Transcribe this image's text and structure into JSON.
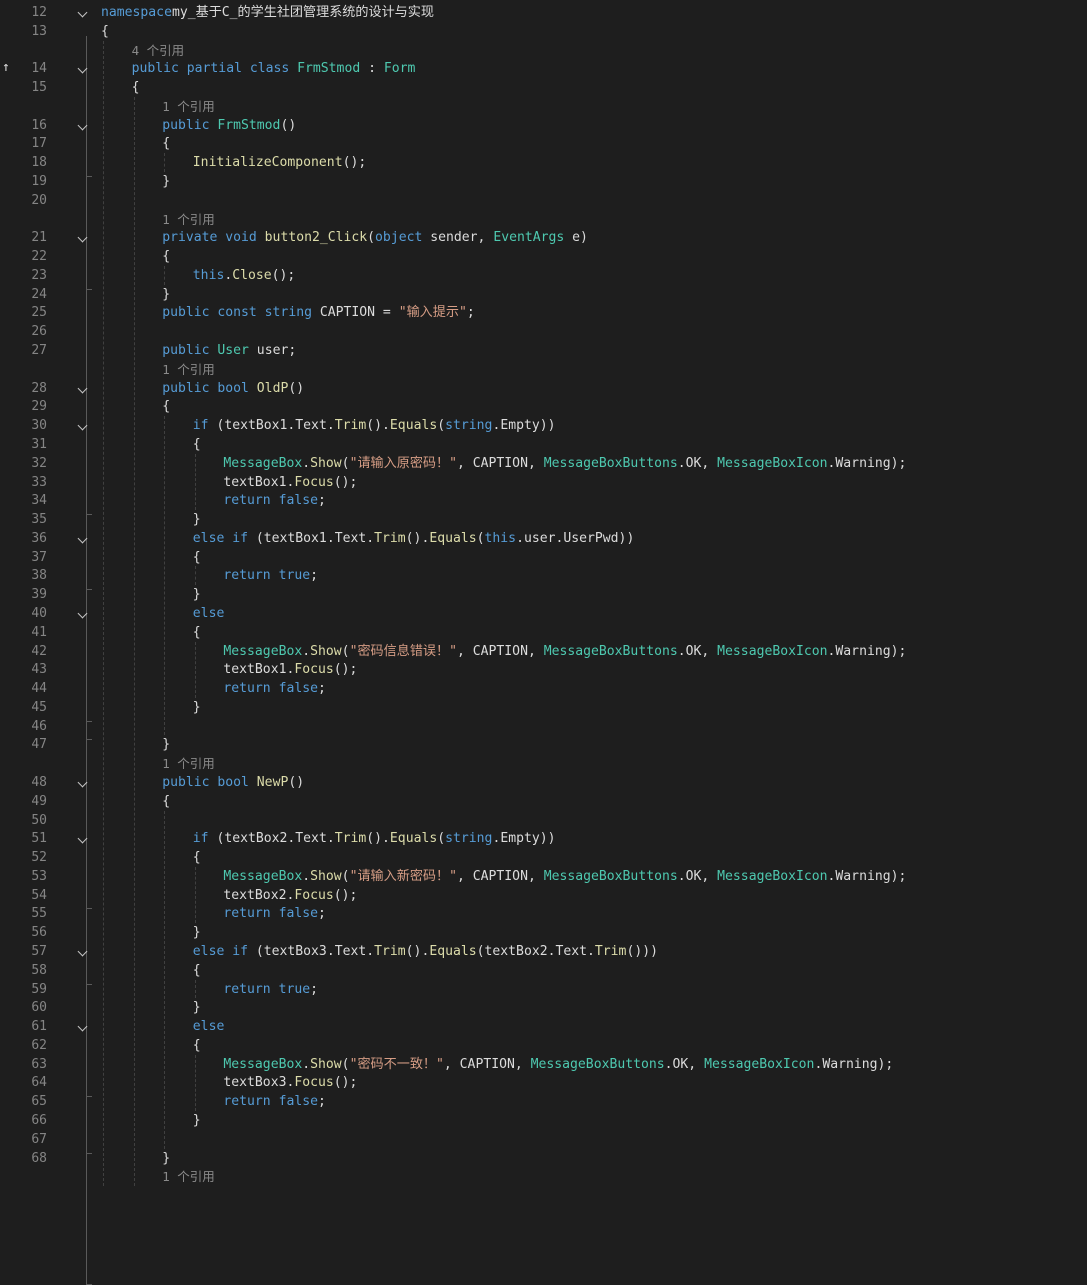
{
  "lines": [
    {
      "n": "12",
      "fold": true,
      "i": 0,
      "tokens": [
        [
          "k",
          "namespace"
        ],
        [
          "",
          "my_基于C_的学生社团管理系统的设计与实现"
        ]
      ]
    },
    {
      "n": "13",
      "i": 0,
      "tokens": [
        [
          "",
          "{"
        ]
      ]
    },
    {
      "i": 1,
      "lens": "4 个引用"
    },
    {
      "n": "14",
      "fold": true,
      "i": 1,
      "tokens": [
        [
          "k",
          "public partial class "
        ],
        [
          "t",
          "FrmStmod"
        ],
        [
          "",
          " : "
        ],
        [
          "t",
          "Form"
        ]
      ]
    },
    {
      "n": "15",
      "i": 1,
      "tokens": [
        [
          "",
          "{"
        ]
      ]
    },
    {
      "i": 2,
      "lens": "1 个引用"
    },
    {
      "n": "16",
      "fold": true,
      "i": 2,
      "tokens": [
        [
          "k",
          "public "
        ],
        [
          "t",
          "FrmStmod"
        ],
        [
          "",
          "()"
        ]
      ]
    },
    {
      "n": "17",
      "i": 2,
      "tokens": [
        [
          "",
          "{"
        ]
      ]
    },
    {
      "n": "18",
      "i": 3,
      "tokens": [
        [
          "m",
          "InitializeComponent"
        ],
        [
          "",
          "();"
        ]
      ]
    },
    {
      "n": "19",
      "i": 2,
      "tokens": [
        [
          "",
          "}"
        ]
      ]
    },
    {
      "n": "20",
      "i": 2,
      "tokens": []
    },
    {
      "i": 2,
      "lens": "1 个引用"
    },
    {
      "n": "21",
      "fold": true,
      "i": 2,
      "tokens": [
        [
          "k",
          "private void "
        ],
        [
          "m",
          "button2_Click"
        ],
        [
          "",
          "("
        ],
        [
          "k",
          "object"
        ],
        [
          "",
          " sender, "
        ],
        [
          "t",
          "EventArgs"
        ],
        [
          "",
          " e)"
        ]
      ]
    },
    {
      "n": "22",
      "i": 2,
      "tokens": [
        [
          "",
          "{"
        ]
      ]
    },
    {
      "n": "23",
      "i": 3,
      "tokens": [
        [
          "k",
          "this"
        ],
        [
          "",
          "."
        ],
        [
          "m",
          "Close"
        ],
        [
          "",
          "();"
        ]
      ]
    },
    {
      "n": "24",
      "i": 2,
      "tokens": [
        [
          "",
          "}"
        ]
      ]
    },
    {
      "n": "25",
      "i": 2,
      "tokens": [
        [
          "k",
          "public const string "
        ],
        [
          "",
          "CAPTION = "
        ],
        [
          "s",
          "\"输入提示\""
        ],
        [
          "",
          ";"
        ]
      ]
    },
    {
      "n": "26",
      "i": 2,
      "tokens": []
    },
    {
      "n": "27",
      "i": 2,
      "tokens": [
        [
          "k",
          "public "
        ],
        [
          "t",
          "User"
        ],
        [
          "",
          " user;"
        ]
      ]
    },
    {
      "i": 2,
      "lens": "1 个引用"
    },
    {
      "n": "28",
      "fold": true,
      "i": 2,
      "tokens": [
        [
          "k",
          "public bool "
        ],
        [
          "m",
          "OldP"
        ],
        [
          "",
          "()"
        ]
      ]
    },
    {
      "n": "29",
      "i": 2,
      "tokens": [
        [
          "",
          "{"
        ]
      ]
    },
    {
      "n": "30",
      "fold": true,
      "i": 3,
      "tokens": [
        [
          "k",
          "if"
        ],
        [
          "",
          " (textBox1.Text."
        ],
        [
          "m",
          "Trim"
        ],
        [
          "",
          "()."
        ],
        [
          "m",
          "Equals"
        ],
        [
          "",
          "("
        ],
        [
          "k",
          "string"
        ],
        [
          "",
          ".Empty))"
        ]
      ]
    },
    {
      "n": "31",
      "i": 3,
      "tokens": [
        [
          "",
          "{"
        ]
      ]
    },
    {
      "n": "32",
      "i": 4,
      "tokens": [
        [
          "t",
          "MessageBox"
        ],
        [
          "",
          "."
        ],
        [
          "m",
          "Show"
        ],
        [
          "",
          "("
        ],
        [
          "s",
          "\"请输入原密码！\""
        ],
        [
          "",
          ", CAPTION, "
        ],
        [
          "t",
          "MessageBoxButtons"
        ],
        [
          "",
          ".OK, "
        ],
        [
          "t",
          "MessageBoxIcon"
        ],
        [
          "",
          ".Warning);"
        ]
      ]
    },
    {
      "n": "33",
      "i": 4,
      "tokens": [
        [
          "",
          "textBox1."
        ],
        [
          "m",
          "Focus"
        ],
        [
          "",
          "();"
        ]
      ]
    },
    {
      "n": "34",
      "i": 4,
      "tokens": [
        [
          "k",
          "return false"
        ],
        [
          "",
          ";"
        ]
      ]
    },
    {
      "n": "35",
      "i": 3,
      "tokens": [
        [
          "",
          "}"
        ]
      ]
    },
    {
      "n": "36",
      "fold": true,
      "i": 3,
      "tokens": [
        [
          "k",
          "else if"
        ],
        [
          "",
          " (textBox1.Text."
        ],
        [
          "m",
          "Trim"
        ],
        [
          "",
          "()."
        ],
        [
          "m",
          "Equals"
        ],
        [
          "",
          "("
        ],
        [
          "k",
          "this"
        ],
        [
          "",
          ".user.UserPwd))"
        ]
      ]
    },
    {
      "n": "37",
      "i": 3,
      "tokens": [
        [
          "",
          "{"
        ]
      ]
    },
    {
      "n": "38",
      "i": 4,
      "tokens": [
        [
          "k",
          "return true"
        ],
        [
          "",
          ";"
        ]
      ]
    },
    {
      "n": "39",
      "i": 3,
      "tokens": [
        [
          "",
          "}"
        ]
      ]
    },
    {
      "n": "40",
      "fold": true,
      "i": 3,
      "tokens": [
        [
          "k",
          "else"
        ]
      ]
    },
    {
      "n": "41",
      "i": 3,
      "tokens": [
        [
          "",
          "{"
        ]
      ]
    },
    {
      "n": "42",
      "i": 4,
      "tokens": [
        [
          "t",
          "MessageBox"
        ],
        [
          "",
          "."
        ],
        [
          "m",
          "Show"
        ],
        [
          "",
          "("
        ],
        [
          "s",
          "\"密码信息错误！\""
        ],
        [
          "",
          ", CAPTION, "
        ],
        [
          "t",
          "MessageBoxButtons"
        ],
        [
          "",
          ".OK, "
        ],
        [
          "t",
          "MessageBoxIcon"
        ],
        [
          "",
          ".Warning);"
        ]
      ]
    },
    {
      "n": "43",
      "i": 4,
      "tokens": [
        [
          "",
          "textBox1."
        ],
        [
          "m",
          "Focus"
        ],
        [
          "",
          "();"
        ]
      ]
    },
    {
      "n": "44",
      "i": 4,
      "tokens": [
        [
          "k",
          "return false"
        ],
        [
          "",
          ";"
        ]
      ]
    },
    {
      "n": "45",
      "i": 3,
      "tokens": [
        [
          "",
          "}"
        ]
      ]
    },
    {
      "n": "46",
      "i": 3,
      "tokens": []
    },
    {
      "n": "47",
      "i": 2,
      "tokens": [
        [
          "",
          "}"
        ]
      ]
    },
    {
      "i": 2,
      "lens": "1 个引用"
    },
    {
      "n": "48",
      "fold": true,
      "i": 2,
      "tokens": [
        [
          "k",
          "public bool "
        ],
        [
          "m",
          "NewP"
        ],
        [
          "",
          "()"
        ]
      ]
    },
    {
      "n": "49",
      "i": 2,
      "tokens": [
        [
          "",
          "{"
        ]
      ]
    },
    {
      "n": "50",
      "i": 3,
      "tokens": []
    },
    {
      "n": "51",
      "fold": true,
      "i": 3,
      "tokens": [
        [
          "k",
          "if"
        ],
        [
          "",
          " (textBox2.Text."
        ],
        [
          "m",
          "Trim"
        ],
        [
          "",
          "()."
        ],
        [
          "m",
          "Equals"
        ],
        [
          "",
          "("
        ],
        [
          "k",
          "string"
        ],
        [
          "",
          ".Empty))"
        ]
      ]
    },
    {
      "n": "52",
      "i": 3,
      "tokens": [
        [
          "",
          "{"
        ]
      ]
    },
    {
      "n": "53",
      "i": 4,
      "tokens": [
        [
          "t",
          "MessageBox"
        ],
        [
          "",
          "."
        ],
        [
          "m",
          "Show"
        ],
        [
          "",
          "("
        ],
        [
          "s",
          "\"请输入新密码！\""
        ],
        [
          "",
          ", CAPTION, "
        ],
        [
          "t",
          "MessageBoxButtons"
        ],
        [
          "",
          ".OK, "
        ],
        [
          "t",
          "MessageBoxIcon"
        ],
        [
          "",
          ".Warning);"
        ]
      ]
    },
    {
      "n": "54",
      "i": 4,
      "tokens": [
        [
          "",
          "textBox2."
        ],
        [
          "m",
          "Focus"
        ],
        [
          "",
          "();"
        ]
      ]
    },
    {
      "n": "55",
      "i": 4,
      "tokens": [
        [
          "k",
          "return false"
        ],
        [
          "",
          ";"
        ]
      ]
    },
    {
      "n": "56",
      "i": 3,
      "tokens": [
        [
          "",
          "}"
        ]
      ]
    },
    {
      "n": "57",
      "fold": true,
      "i": 3,
      "tokens": [
        [
          "k",
          "else if"
        ],
        [
          "",
          " (textBox3.Text."
        ],
        [
          "m",
          "Trim"
        ],
        [
          "",
          "()."
        ],
        [
          "m",
          "Equals"
        ],
        [
          "",
          "(textBox2.Text."
        ],
        [
          "m",
          "Trim"
        ],
        [
          "",
          "()))"
        ]
      ]
    },
    {
      "n": "58",
      "i": 3,
      "tokens": [
        [
          "",
          "{"
        ]
      ]
    },
    {
      "n": "59",
      "i": 4,
      "tokens": [
        [
          "k",
          "return true"
        ],
        [
          "",
          ";"
        ]
      ]
    },
    {
      "n": "60",
      "i": 3,
      "tokens": [
        [
          "",
          "}"
        ]
      ]
    },
    {
      "n": "61",
      "fold": true,
      "i": 3,
      "tokens": [
        [
          "k",
          "else"
        ]
      ]
    },
    {
      "n": "62",
      "i": 3,
      "tokens": [
        [
          "",
          "{"
        ]
      ]
    },
    {
      "n": "63",
      "i": 4,
      "tokens": [
        [
          "t",
          "MessageBox"
        ],
        [
          "",
          "."
        ],
        [
          "m",
          "Show"
        ],
        [
          "",
          "("
        ],
        [
          "s",
          "\"密码不一致！\""
        ],
        [
          "",
          ", CAPTION, "
        ],
        [
          "t",
          "MessageBoxButtons"
        ],
        [
          "",
          ".OK, "
        ],
        [
          "t",
          "MessageBoxIcon"
        ],
        [
          "",
          ".Warning);"
        ]
      ]
    },
    {
      "n": "64",
      "i": 4,
      "tokens": [
        [
          "",
          "textBox3."
        ],
        [
          "m",
          "Focus"
        ],
        [
          "",
          "();"
        ]
      ]
    },
    {
      "n": "65",
      "i": 4,
      "tokens": [
        [
          "k",
          "return false"
        ],
        [
          "",
          ";"
        ]
      ]
    },
    {
      "n": "66",
      "i": 3,
      "tokens": [
        [
          "",
          "}"
        ]
      ]
    },
    {
      "n": "67",
      "i": 3,
      "tokens": []
    },
    {
      "n": "68",
      "i": 2,
      "tokens": [
        [
          "",
          "}"
        ]
      ]
    },
    {
      "i": 2,
      "lens": "1 个引用"
    }
  ]
}
